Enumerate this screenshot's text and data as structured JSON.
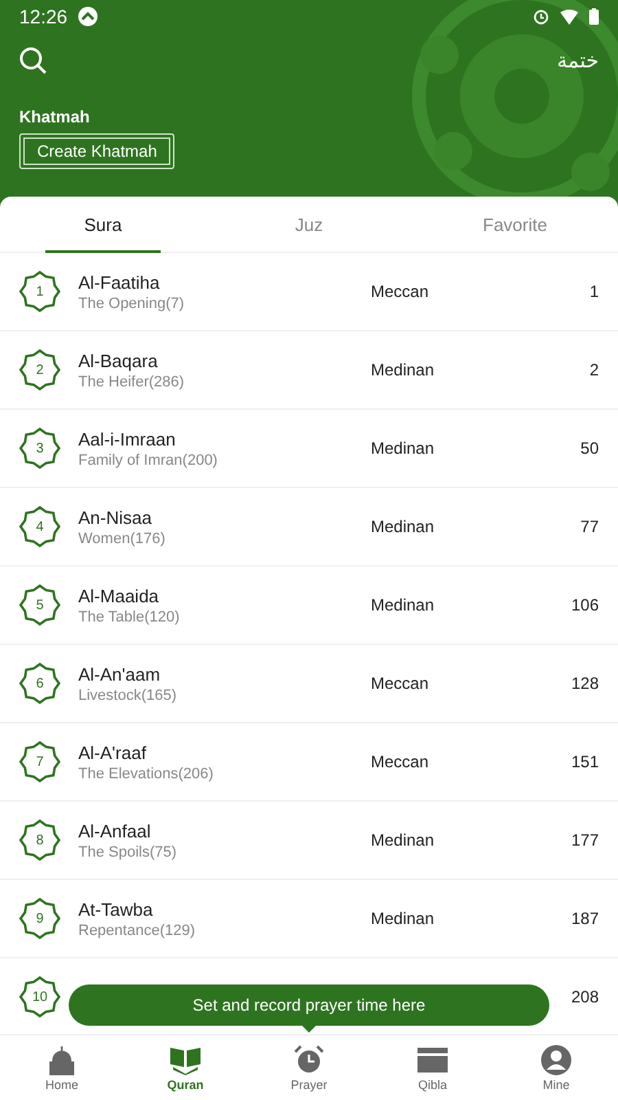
{
  "status_bar": {
    "time": "12:26"
  },
  "header": {
    "title_arabic": "ختمة",
    "section_label": "Khatmah",
    "button": "Create Khatmah"
  },
  "tabs": [
    {
      "label": "Sura",
      "selected": true
    },
    {
      "label": "Juz",
      "selected": false
    },
    {
      "label": "Favorite",
      "selected": false
    }
  ],
  "suras": [
    {
      "number": "1",
      "name": "Al-Faatiha",
      "subtitle": "The Opening(7)",
      "type": "Meccan",
      "page": "1"
    },
    {
      "number": "2",
      "name": "Al-Baqara",
      "subtitle": "The Heifer(286)",
      "type": "Medinan",
      "page": "2"
    },
    {
      "number": "3",
      "name": "Aal-i-Imraan",
      "subtitle": "Family of Imran(200)",
      "type": "Medinan",
      "page": "50"
    },
    {
      "number": "4",
      "name": "An-Nisaa",
      "subtitle": "Women(176)",
      "type": "Medinan",
      "page": "77"
    },
    {
      "number": "5",
      "name": "Al-Maaida",
      "subtitle": "The Table(120)",
      "type": "Medinan",
      "page": "106"
    },
    {
      "number": "6",
      "name": "Al-An'aam",
      "subtitle": "Livestock(165)",
      "type": "Meccan",
      "page": "128"
    },
    {
      "number": "7",
      "name": "Al-A'raaf",
      "subtitle": "The Elevations(206)",
      "type": "Meccan",
      "page": "151"
    },
    {
      "number": "8",
      "name": "Al-Anfaal",
      "subtitle": "The Spoils(75)",
      "type": "Medinan",
      "page": "177"
    },
    {
      "number": "9",
      "name": "At-Tawba",
      "subtitle": "Repentance(129)",
      "type": "Medinan",
      "page": "187"
    },
    {
      "number": "10",
      "page": "208"
    }
  ],
  "tooltip": "Set and record prayer time here",
  "nav": [
    {
      "kind": "home",
      "label": "Home",
      "selected": false
    },
    {
      "kind": "quran",
      "label": "Quran",
      "selected": true
    },
    {
      "kind": "prayer",
      "label": "Prayer",
      "selected": false
    },
    {
      "kind": "qibla",
      "label": "Qibla",
      "selected": false
    },
    {
      "kind": "mine",
      "label": "Mine",
      "selected": false
    }
  ]
}
